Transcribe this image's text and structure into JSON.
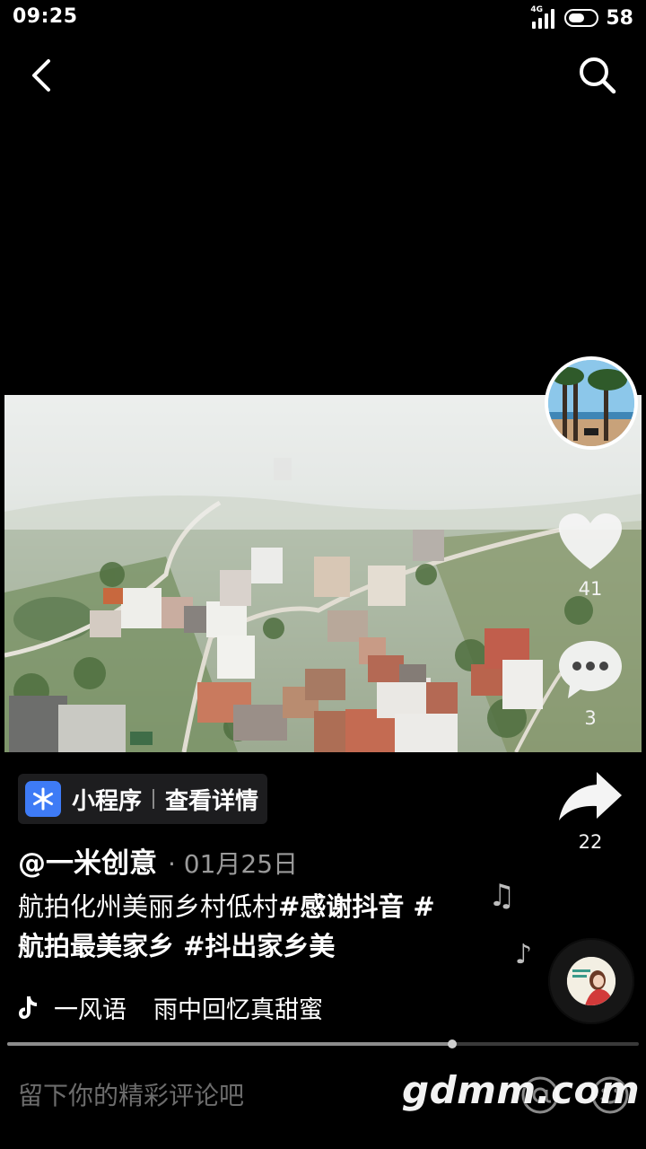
{
  "status_bar": {
    "time": "09:25",
    "network": "4G",
    "battery": "58",
    "battery_level": 0.58
  },
  "nav": {
    "back_icon": "back-arrow-icon",
    "search_icon": "search-icon"
  },
  "video": {
    "description": "aerial village scene"
  },
  "right_rail": {
    "like_count": "41",
    "comment_count": "3",
    "share_count": "22"
  },
  "mini_program": {
    "label": "小程序",
    "action": "查看详情"
  },
  "caption": {
    "author": "@一米创意",
    "date": "· 01月25日",
    "text_plain": "航拍化州美丽乡村低村",
    "tag_thanks": "#感谢抖音",
    "tag_hash": " #",
    "tag_hometown": "航拍最美家乡",
    "tag_space": " ",
    "tag_dou": "#抖出家乡美"
  },
  "music": {
    "artist": "一风语",
    "title": "雨中回忆真甜蜜"
  },
  "progress": {
    "fraction": 0.705
  },
  "comment_bar": {
    "placeholder": "留下你的精彩评论吧",
    "watermark": "gdmm.com"
  },
  "colors": {
    "background": "#000000",
    "chip_icon": "#3e7bf6",
    "secondary_text": "#9a9a9a"
  }
}
